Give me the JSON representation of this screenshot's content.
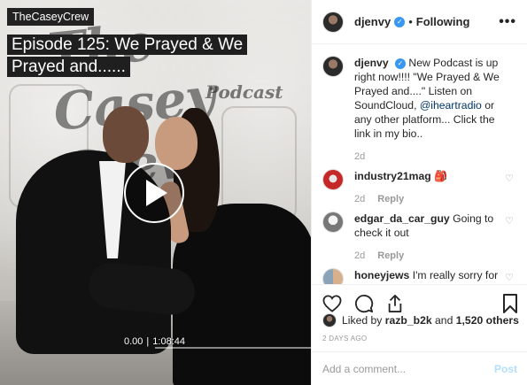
{
  "media": {
    "channel_label": "TheCaseyCrew",
    "episode_title": "Episode 125: We Prayed & We Prayed and......",
    "logo_text": "The Casey Crew",
    "logo_subtext": "Podcast",
    "current_time": "0.00",
    "separator": "|",
    "duration": "1:08:44",
    "progress_fraction": 0.0
  },
  "header": {
    "username": "djenvy",
    "verified_mark": "✓",
    "dot": "•",
    "follow_status": "Following",
    "more_label": "•••"
  },
  "comments": [
    {
      "username": "djenvy",
      "avatar": "djenvy-avatar",
      "text_before_link": "New Podcast is up right now!!!! \"We Prayed & We Prayed and....\" Listen on SoundCloud,",
      "link": "@iheartradio",
      "text_after_link": "or any other platform... Click the link in my bio..",
      "age": "2d"
    },
    {
      "username": "industry21mag",
      "avatar": "industry21mag-avatar",
      "text": "",
      "emoji": "🎒",
      "age": "2d",
      "reply_label": "Reply"
    },
    {
      "username": "edgar_da_car_guy",
      "avatar": "edgar-avatar",
      "text": "Going to check it out",
      "age": "2d",
      "reply_label": "Reply"
    },
    {
      "username": "honeyjews",
      "avatar": "honeyjews-avatar",
      "text": "I'm really sorry for the lost both of you suffered. Gia you're an amazing and strong"
    }
  ],
  "likes": {
    "prefix": "Liked by",
    "liker": "razb_b2k",
    "conjunction": "and",
    "others": "1,520 others"
  },
  "timestamp": "2 DAYS AGO",
  "add_comment": {
    "placeholder": "Add a comment...",
    "post_label": "Post"
  },
  "colors": {
    "link": "#003569",
    "verified": "#3897f0",
    "post_disabled": "#b2dffc"
  }
}
